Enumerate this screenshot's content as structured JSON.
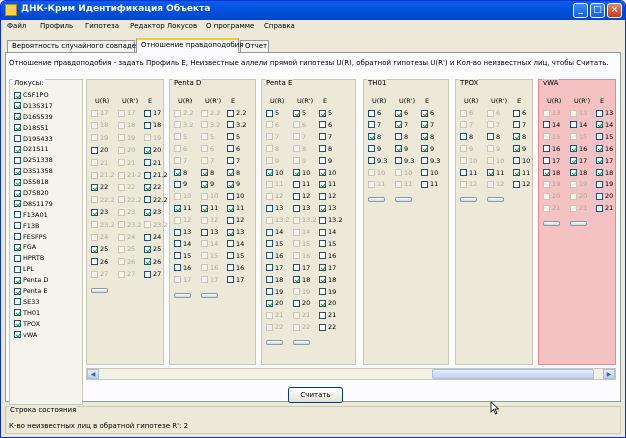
{
  "window": {
    "title": "ДНК-Крим Идентификация Объекта",
    "minimize": "_",
    "maximize": "□",
    "close": "×"
  },
  "menu": [
    "Файл",
    "Профиль",
    "Гипотеза",
    "Редактор Локусов",
    "О программе",
    "Справка"
  ],
  "tabs": [
    {
      "label": "Вероятность случайного совпадения",
      "active": false
    },
    {
      "label": "Отношение правдоподобия",
      "active": true
    },
    {
      "label": "Отчет",
      "active": false
    }
  ],
  "description": "Отношение правдоподобия - задать Профиль Е, Неизвестные аллели прямой гипотезы U(R), обратной гипотезы U(R') и Кол-во неизвестных лиц, чтобы Считать.",
  "loci_title": "Локусы:",
  "loci": [
    {
      "name": "CSF1PO",
      "checked": true
    },
    {
      "name": "D13S317",
      "checked": true
    },
    {
      "name": "D16S539",
      "checked": true
    },
    {
      "name": "D18S51",
      "checked": true
    },
    {
      "name": "D19S433",
      "checked": false
    },
    {
      "name": "D21S11",
      "checked": true
    },
    {
      "name": "D2S1338",
      "checked": false
    },
    {
      "name": "D3S1358",
      "checked": true
    },
    {
      "name": "D5S818",
      "checked": true
    },
    {
      "name": "D7S820",
      "checked": true
    },
    {
      "name": "D8S1179",
      "checked": true
    },
    {
      "name": "F13A01",
      "checked": false
    },
    {
      "name": "F13B",
      "checked": false
    },
    {
      "name": "FESFPS",
      "checked": false
    },
    {
      "name": "FGA",
      "checked": true
    },
    {
      "name": "HPRTB",
      "checked": false
    },
    {
      "name": "LPL",
      "checked": false
    },
    {
      "name": "Penta D",
      "checked": true
    },
    {
      "name": "Penta E",
      "checked": true
    },
    {
      "name": "SE33",
      "checked": false
    },
    {
      "name": "TH01",
      "checked": true
    },
    {
      "name": "TPOX",
      "checked": true
    },
    {
      "name": "vWA",
      "checked": true
    }
  ],
  "column_headers": [
    "U(R)",
    "U(R')",
    "E"
  ],
  "markers": [
    {
      "name": "",
      "alleles": [
        [
          "17",
          "d0",
          "d0",
          "e0"
        ],
        [
          "18",
          "d0",
          "d0",
          "e0"
        ],
        [
          "19",
          "d0",
          "d0",
          "d0"
        ],
        [
          "20",
          "e0",
          "d0",
          "e1"
        ],
        [
          "21",
          "d0",
          "d0",
          "e0"
        ],
        [
          "21.2",
          "d0",
          "d0",
          "e0"
        ],
        [
          "22",
          "e1",
          "d0",
          "e1"
        ],
        [
          "22.2",
          "d0",
          "d0",
          "e0"
        ],
        [
          "23",
          "e1",
          "d0",
          "e1"
        ],
        [
          "23.2",
          "d0",
          "d0",
          "d0"
        ],
        [
          "24",
          "d0",
          "d0",
          "e0"
        ],
        [
          "25",
          "e1",
          "d0",
          "e1"
        ],
        [
          "26",
          "e0",
          "d0",
          "e1"
        ],
        [
          "27",
          "d0",
          "d0",
          "e0"
        ]
      ]
    },
    {
      "name": "Penta D",
      "alleles": [
        [
          "2.2",
          "d0",
          "d0",
          "e0"
        ],
        [
          "3.2",
          "d0",
          "d0",
          "e0"
        ],
        [
          "5",
          "d0",
          "d0",
          "e0"
        ],
        [
          "6",
          "d0",
          "d0",
          "e0"
        ],
        [
          "7",
          "d0",
          "d0",
          "e0"
        ],
        [
          "8",
          "e1",
          "e1",
          "e1"
        ],
        [
          "9",
          "e0",
          "e1",
          "e1"
        ],
        [
          "10",
          "d0",
          "d0",
          "e0"
        ],
        [
          "11",
          "e1",
          "e1",
          "e1"
        ],
        [
          "12",
          "d0",
          "d0",
          "e0"
        ],
        [
          "13",
          "e0",
          "e0",
          "e1"
        ],
        [
          "14",
          "e0",
          "d0",
          "e0"
        ],
        [
          "15",
          "e0",
          "d0",
          "e0"
        ],
        [
          "16",
          "e0",
          "d0",
          "e0"
        ],
        [
          "17",
          "d0",
          "d0",
          "e0"
        ]
      ]
    },
    {
      "name": "Penta E",
      "alleles": [
        [
          "5",
          "e0",
          "e1",
          "e1"
        ],
        [
          "6",
          "d0",
          "d0",
          "e0"
        ],
        [
          "7",
          "d0",
          "d0",
          "e0"
        ],
        [
          "8",
          "d0",
          "d0",
          "e0"
        ],
        [
          "9",
          "d0",
          "d0",
          "e0"
        ],
        [
          "10",
          "e1",
          "e1",
          "e1"
        ],
        [
          "11",
          "d0",
          "e0",
          "e1"
        ],
        [
          "12",
          "d0",
          "e0",
          "e0"
        ],
        [
          "13",
          "e0",
          "e0",
          "e1"
        ],
        [
          "13.2",
          "d0",
          "d0",
          "e0"
        ],
        [
          "14",
          "e0",
          "d0",
          "e0"
        ],
        [
          "15",
          "e0",
          "d0",
          "e0"
        ],
        [
          "16",
          "e0",
          "d0",
          "e0"
        ],
        [
          "17",
          "e0",
          "e0",
          "e1"
        ],
        [
          "18",
          "e0",
          "e1",
          "e1"
        ],
        [
          "19",
          "e0",
          "d0",
          "e0"
        ],
        [
          "20",
          "e1",
          "e0",
          "e1"
        ],
        [
          "21",
          "d0",
          "d0",
          "e0"
        ],
        [
          "22",
          "d0",
          "d0",
          "e0"
        ]
      ]
    },
    {
      "name": "TH01",
      "alleles": [
        [
          "6",
          "e0",
          "e1",
          "e1"
        ],
        [
          "7",
          "e0",
          "e1",
          "e1"
        ],
        [
          "8",
          "e1",
          "e0",
          "e1"
        ],
        [
          "9",
          "e0",
          "e1",
          "e1"
        ],
        [
          "9.3",
          "e0",
          "e0",
          "e0"
        ],
        [
          "10",
          "d0",
          "d0",
          "e0"
        ],
        [
          "11",
          "d0",
          "d0",
          "e0"
        ]
      ]
    },
    {
      "name": "TPOX",
      "alleles": [
        [
          "6",
          "d0",
          "d0",
          "e0"
        ],
        [
          "7",
          "d0",
          "d0",
          "e0"
        ],
        [
          "8",
          "e0",
          "e0",
          "e1"
        ],
        [
          "9",
          "d0",
          "d0",
          "e1"
        ],
        [
          "10",
          "d0",
          "d0",
          "e0"
        ],
        [
          "11",
          "e0",
          "e1",
          "e1"
        ],
        [
          "12",
          "d0",
          "d0",
          "e0"
        ]
      ]
    },
    {
      "name": "vWA",
      "alleles": [
        [
          "13",
          "d0",
          "d0",
          "e0"
        ],
        [
          "14",
          "e0",
          "e0",
          "e1"
        ],
        [
          "15",
          "d0",
          "d0",
          "e0"
        ],
        [
          "16",
          "e0",
          "e1",
          "e1"
        ],
        [
          "17",
          "e0",
          "e1",
          "e1"
        ],
        [
          "18",
          "e1",
          "e1",
          "e1"
        ],
        [
          "19",
          "d0",
          "d0",
          "e0"
        ],
        [
          "20",
          "d0",
          "d0",
          "e0"
        ],
        [
          "21",
          "d0",
          "d0",
          "e0"
        ]
      ]
    }
  ],
  "calc_button": "Считать",
  "status_title": "Строка состояния",
  "status_text": "К-во неизвестных лиц в обратной гипотезе R': 2",
  "colors": {
    "selected_column": "#F4C2C2",
    "titlebar": "#0053E1",
    "check": "#21A121"
  }
}
